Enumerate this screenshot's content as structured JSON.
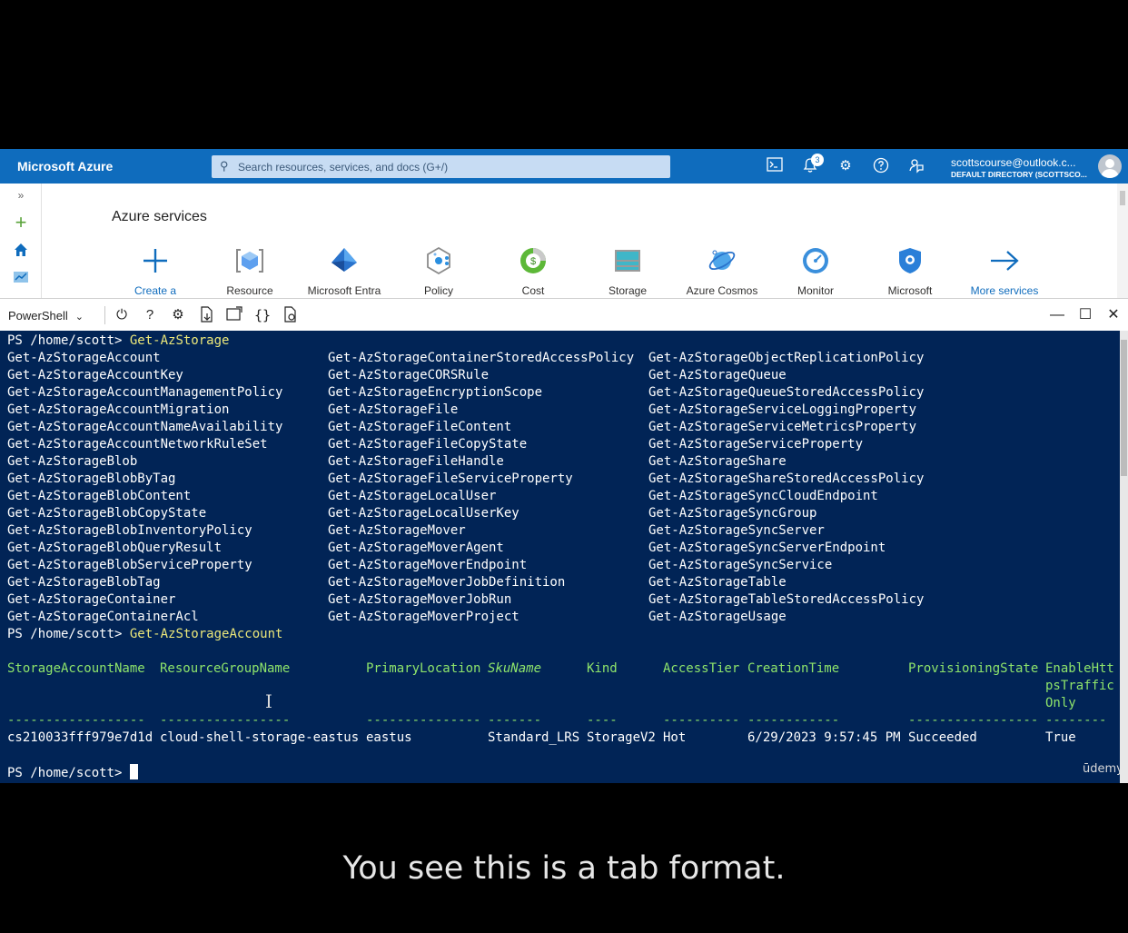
{
  "colors": {
    "azure_blue": "#0f6cbd",
    "terminal_bg": "#012456",
    "prompt_cmd": "#ebe77a",
    "header_green": "#8ee46b"
  },
  "topbar": {
    "brand": "Microsoft Azure",
    "search_placeholder": "Search resources, services, and docs (G+/)",
    "notifications_count": "3",
    "account_email": "scottscourse@outlook.c...",
    "account_directory": "DEFAULT DIRECTORY (SCOTTSCO..."
  },
  "portal": {
    "services_title": "Azure services",
    "services": [
      {
        "label": "Create a",
        "icon": "plus-icon"
      },
      {
        "label": "Resource",
        "icon": "resource-icon"
      },
      {
        "label": "Microsoft Entra",
        "icon": "entra-icon"
      },
      {
        "label": "Policy",
        "icon": "policy-icon"
      },
      {
        "label": "Cost",
        "icon": "cost-icon"
      },
      {
        "label": "Storage",
        "icon": "storage-icon"
      },
      {
        "label": "Azure Cosmos",
        "icon": "cosmos-icon"
      },
      {
        "label": "Monitor",
        "icon": "monitor-icon"
      },
      {
        "label": "Microsoft",
        "icon": "defender-icon"
      },
      {
        "label": "More services",
        "icon": "arrow-right-icon"
      }
    ]
  },
  "shell": {
    "selected_shell": "PowerShell",
    "toolbar_icons": [
      "power-icon",
      "help-icon",
      "settings-icon",
      "upload-download-icon",
      "open-new-session-icon",
      "editor-icon",
      "web-preview-icon"
    ]
  },
  "terminal": {
    "prompt": "PS /home/scott>",
    "command1": "Get-AzStorage",
    "completions": [
      [
        "Get-AzStorageAccount",
        "Get-AzStorageContainerStoredAccessPolicy",
        "Get-AzStorageObjectReplicationPolicy"
      ],
      [
        "Get-AzStorageAccountKey",
        "Get-AzStorageCORSRule",
        "Get-AzStorageQueue"
      ],
      [
        "Get-AzStorageAccountManagementPolicy",
        "Get-AzStorageEncryptionScope",
        "Get-AzStorageQueueStoredAccessPolicy"
      ],
      [
        "Get-AzStorageAccountMigration",
        "Get-AzStorageFile",
        "Get-AzStorageServiceLoggingProperty"
      ],
      [
        "Get-AzStorageAccountNameAvailability",
        "Get-AzStorageFileContent",
        "Get-AzStorageServiceMetricsProperty"
      ],
      [
        "Get-AzStorageAccountNetworkRuleSet",
        "Get-AzStorageFileCopyState",
        "Get-AzStorageServiceProperty"
      ],
      [
        "Get-AzStorageBlob",
        "Get-AzStorageFileHandle",
        "Get-AzStorageShare"
      ],
      [
        "Get-AzStorageBlobByTag",
        "Get-AzStorageFileServiceProperty",
        "Get-AzStorageShareStoredAccessPolicy"
      ],
      [
        "Get-AzStorageBlobContent",
        "Get-AzStorageLocalUser",
        "Get-AzStorageSyncCloudEndpoint"
      ],
      [
        "Get-AzStorageBlobCopyState",
        "Get-AzStorageLocalUserKey",
        "Get-AzStorageSyncGroup"
      ],
      [
        "Get-AzStorageBlobInventoryPolicy",
        "Get-AzStorageMover",
        "Get-AzStorageSyncServer"
      ],
      [
        "Get-AzStorageBlobQueryResult",
        "Get-AzStorageMoverAgent",
        "Get-AzStorageSyncServerEndpoint"
      ],
      [
        "Get-AzStorageBlobServiceProperty",
        "Get-AzStorageMoverEndpoint",
        "Get-AzStorageSyncService"
      ],
      [
        "Get-AzStorageBlobTag",
        "Get-AzStorageMoverJobDefinition",
        "Get-AzStorageTable"
      ],
      [
        "Get-AzStorageContainer",
        "Get-AzStorageMoverJobRun",
        "Get-AzStorageTableStoredAccessPolicy"
      ],
      [
        "Get-AzStorageContainerAcl",
        "Get-AzStorageMoverProject",
        "Get-AzStorageUsage"
      ]
    ],
    "command2": "Get-AzStorageAccount",
    "table_headers": [
      "StorageAccountName",
      "ResourceGroupName",
      "PrimaryLocation",
      "SkuName",
      "Kind",
      "AccessTier",
      "CreationTime",
      "ProvisioningState",
      "EnableHtt"
    ],
    "header_wrap": [
      "psTraffic",
      "Only"
    ],
    "table_dashes": [
      "------------------",
      "-----------------",
      "---------------",
      "-------",
      "----",
      "----------",
      "------------",
      "-----------------",
      "--------"
    ],
    "table_row": [
      "cs210033fff979e7d1d",
      "cloud-shell-storage-eastus",
      "eastus",
      "Standard_LRS",
      "StorageV2",
      "Hot",
      "6/29/2023 9:57:45 PM",
      "Succeeded",
      "True"
    ],
    "watermark": "ūdemy"
  },
  "caption": "You see this is a tab format."
}
